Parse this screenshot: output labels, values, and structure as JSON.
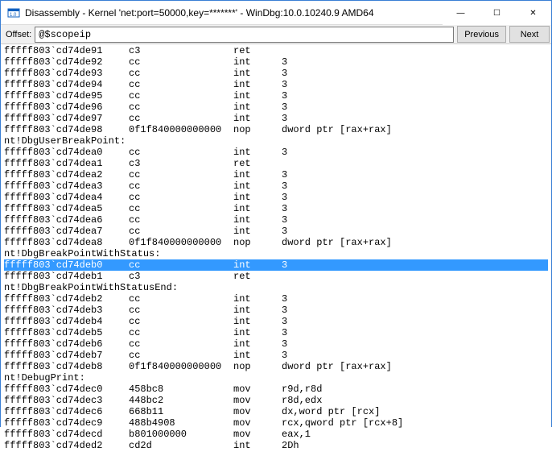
{
  "window": {
    "title": "Disassembly - Kernel 'net:port=50000,key=*******' - WinDbg:10.0.10240.9 AMD64",
    "min_glyph": "—",
    "max_glyph": "☐",
    "close_glyph": "✕"
  },
  "toolbar": {
    "offset_label": "Offset:",
    "offset_value": "@$scopeip",
    "prev_label": "Previous",
    "next_label": "Next"
  },
  "disasm": [
    {
      "t": "i",
      "addr": "fffff803`cd74de91",
      "bytes": "c3",
      "mnem": "ret",
      "ops": ""
    },
    {
      "t": "i",
      "addr": "fffff803`cd74de92",
      "bytes": "cc",
      "mnem": "int",
      "ops": "3"
    },
    {
      "t": "i",
      "addr": "fffff803`cd74de93",
      "bytes": "cc",
      "mnem": "int",
      "ops": "3"
    },
    {
      "t": "i",
      "addr": "fffff803`cd74de94",
      "bytes": "cc",
      "mnem": "int",
      "ops": "3"
    },
    {
      "t": "i",
      "addr": "fffff803`cd74de95",
      "bytes": "cc",
      "mnem": "int",
      "ops": "3"
    },
    {
      "t": "i",
      "addr": "fffff803`cd74de96",
      "bytes": "cc",
      "mnem": "int",
      "ops": "3"
    },
    {
      "t": "i",
      "addr": "fffff803`cd74de97",
      "bytes": "cc",
      "mnem": "int",
      "ops": "3"
    },
    {
      "t": "i",
      "addr": "fffff803`cd74de98",
      "bytes": "0f1f840000000000",
      "mnem": "nop",
      "ops": "dword ptr [rax+rax]"
    },
    {
      "t": "s",
      "text": "nt!DbgUserBreakPoint:"
    },
    {
      "t": "i",
      "addr": "fffff803`cd74dea0",
      "bytes": "cc",
      "mnem": "int",
      "ops": "3"
    },
    {
      "t": "i",
      "addr": "fffff803`cd74dea1",
      "bytes": "c3",
      "mnem": "ret",
      "ops": ""
    },
    {
      "t": "i",
      "addr": "fffff803`cd74dea2",
      "bytes": "cc",
      "mnem": "int",
      "ops": "3"
    },
    {
      "t": "i",
      "addr": "fffff803`cd74dea3",
      "bytes": "cc",
      "mnem": "int",
      "ops": "3"
    },
    {
      "t": "i",
      "addr": "fffff803`cd74dea4",
      "bytes": "cc",
      "mnem": "int",
      "ops": "3"
    },
    {
      "t": "i",
      "addr": "fffff803`cd74dea5",
      "bytes": "cc",
      "mnem": "int",
      "ops": "3"
    },
    {
      "t": "i",
      "addr": "fffff803`cd74dea6",
      "bytes": "cc",
      "mnem": "int",
      "ops": "3"
    },
    {
      "t": "i",
      "addr": "fffff803`cd74dea7",
      "bytes": "cc",
      "mnem": "int",
      "ops": "3"
    },
    {
      "t": "i",
      "addr": "fffff803`cd74dea8",
      "bytes": "0f1f840000000000",
      "mnem": "nop",
      "ops": "dword ptr [rax+rax]"
    },
    {
      "t": "s",
      "text": "nt!DbgBreakPointWithStatus:"
    },
    {
      "t": "i",
      "addr": "fffff803`cd74deb0",
      "bytes": "cc",
      "mnem": "int",
      "ops": "3",
      "sel": true
    },
    {
      "t": "i",
      "addr": "fffff803`cd74deb1",
      "bytes": "c3",
      "mnem": "ret",
      "ops": ""
    },
    {
      "t": "s",
      "text": "nt!DbgBreakPointWithStatusEnd:"
    },
    {
      "t": "i",
      "addr": "fffff803`cd74deb2",
      "bytes": "cc",
      "mnem": "int",
      "ops": "3"
    },
    {
      "t": "i",
      "addr": "fffff803`cd74deb3",
      "bytes": "cc",
      "mnem": "int",
      "ops": "3"
    },
    {
      "t": "i",
      "addr": "fffff803`cd74deb4",
      "bytes": "cc",
      "mnem": "int",
      "ops": "3"
    },
    {
      "t": "i",
      "addr": "fffff803`cd74deb5",
      "bytes": "cc",
      "mnem": "int",
      "ops": "3"
    },
    {
      "t": "i",
      "addr": "fffff803`cd74deb6",
      "bytes": "cc",
      "mnem": "int",
      "ops": "3"
    },
    {
      "t": "i",
      "addr": "fffff803`cd74deb7",
      "bytes": "cc",
      "mnem": "int",
      "ops": "3"
    },
    {
      "t": "i",
      "addr": "fffff803`cd74deb8",
      "bytes": "0f1f840000000000",
      "mnem": "nop",
      "ops": "dword ptr [rax+rax]"
    },
    {
      "t": "s",
      "text": "nt!DebugPrint:"
    },
    {
      "t": "i",
      "addr": "fffff803`cd74dec0",
      "bytes": "458bc8",
      "mnem": "mov",
      "ops": "r9d,r8d"
    },
    {
      "t": "i",
      "addr": "fffff803`cd74dec3",
      "bytes": "448bc2",
      "mnem": "mov",
      "ops": "r8d,edx"
    },
    {
      "t": "i",
      "addr": "fffff803`cd74dec6",
      "bytes": "668b11",
      "mnem": "mov",
      "ops": "dx,word ptr [rcx]"
    },
    {
      "t": "i",
      "addr": "fffff803`cd74dec9",
      "bytes": "488b4908",
      "mnem": "mov",
      "ops": "rcx,qword ptr [rcx+8]"
    },
    {
      "t": "i",
      "addr": "fffff803`cd74decd",
      "bytes": "b801000000",
      "mnem": "mov",
      "ops": "eax,1"
    },
    {
      "t": "i",
      "addr": "fffff803`cd74ded2",
      "bytes": "cd2d",
      "mnem": "int",
      "ops": "2Dh"
    }
  ]
}
